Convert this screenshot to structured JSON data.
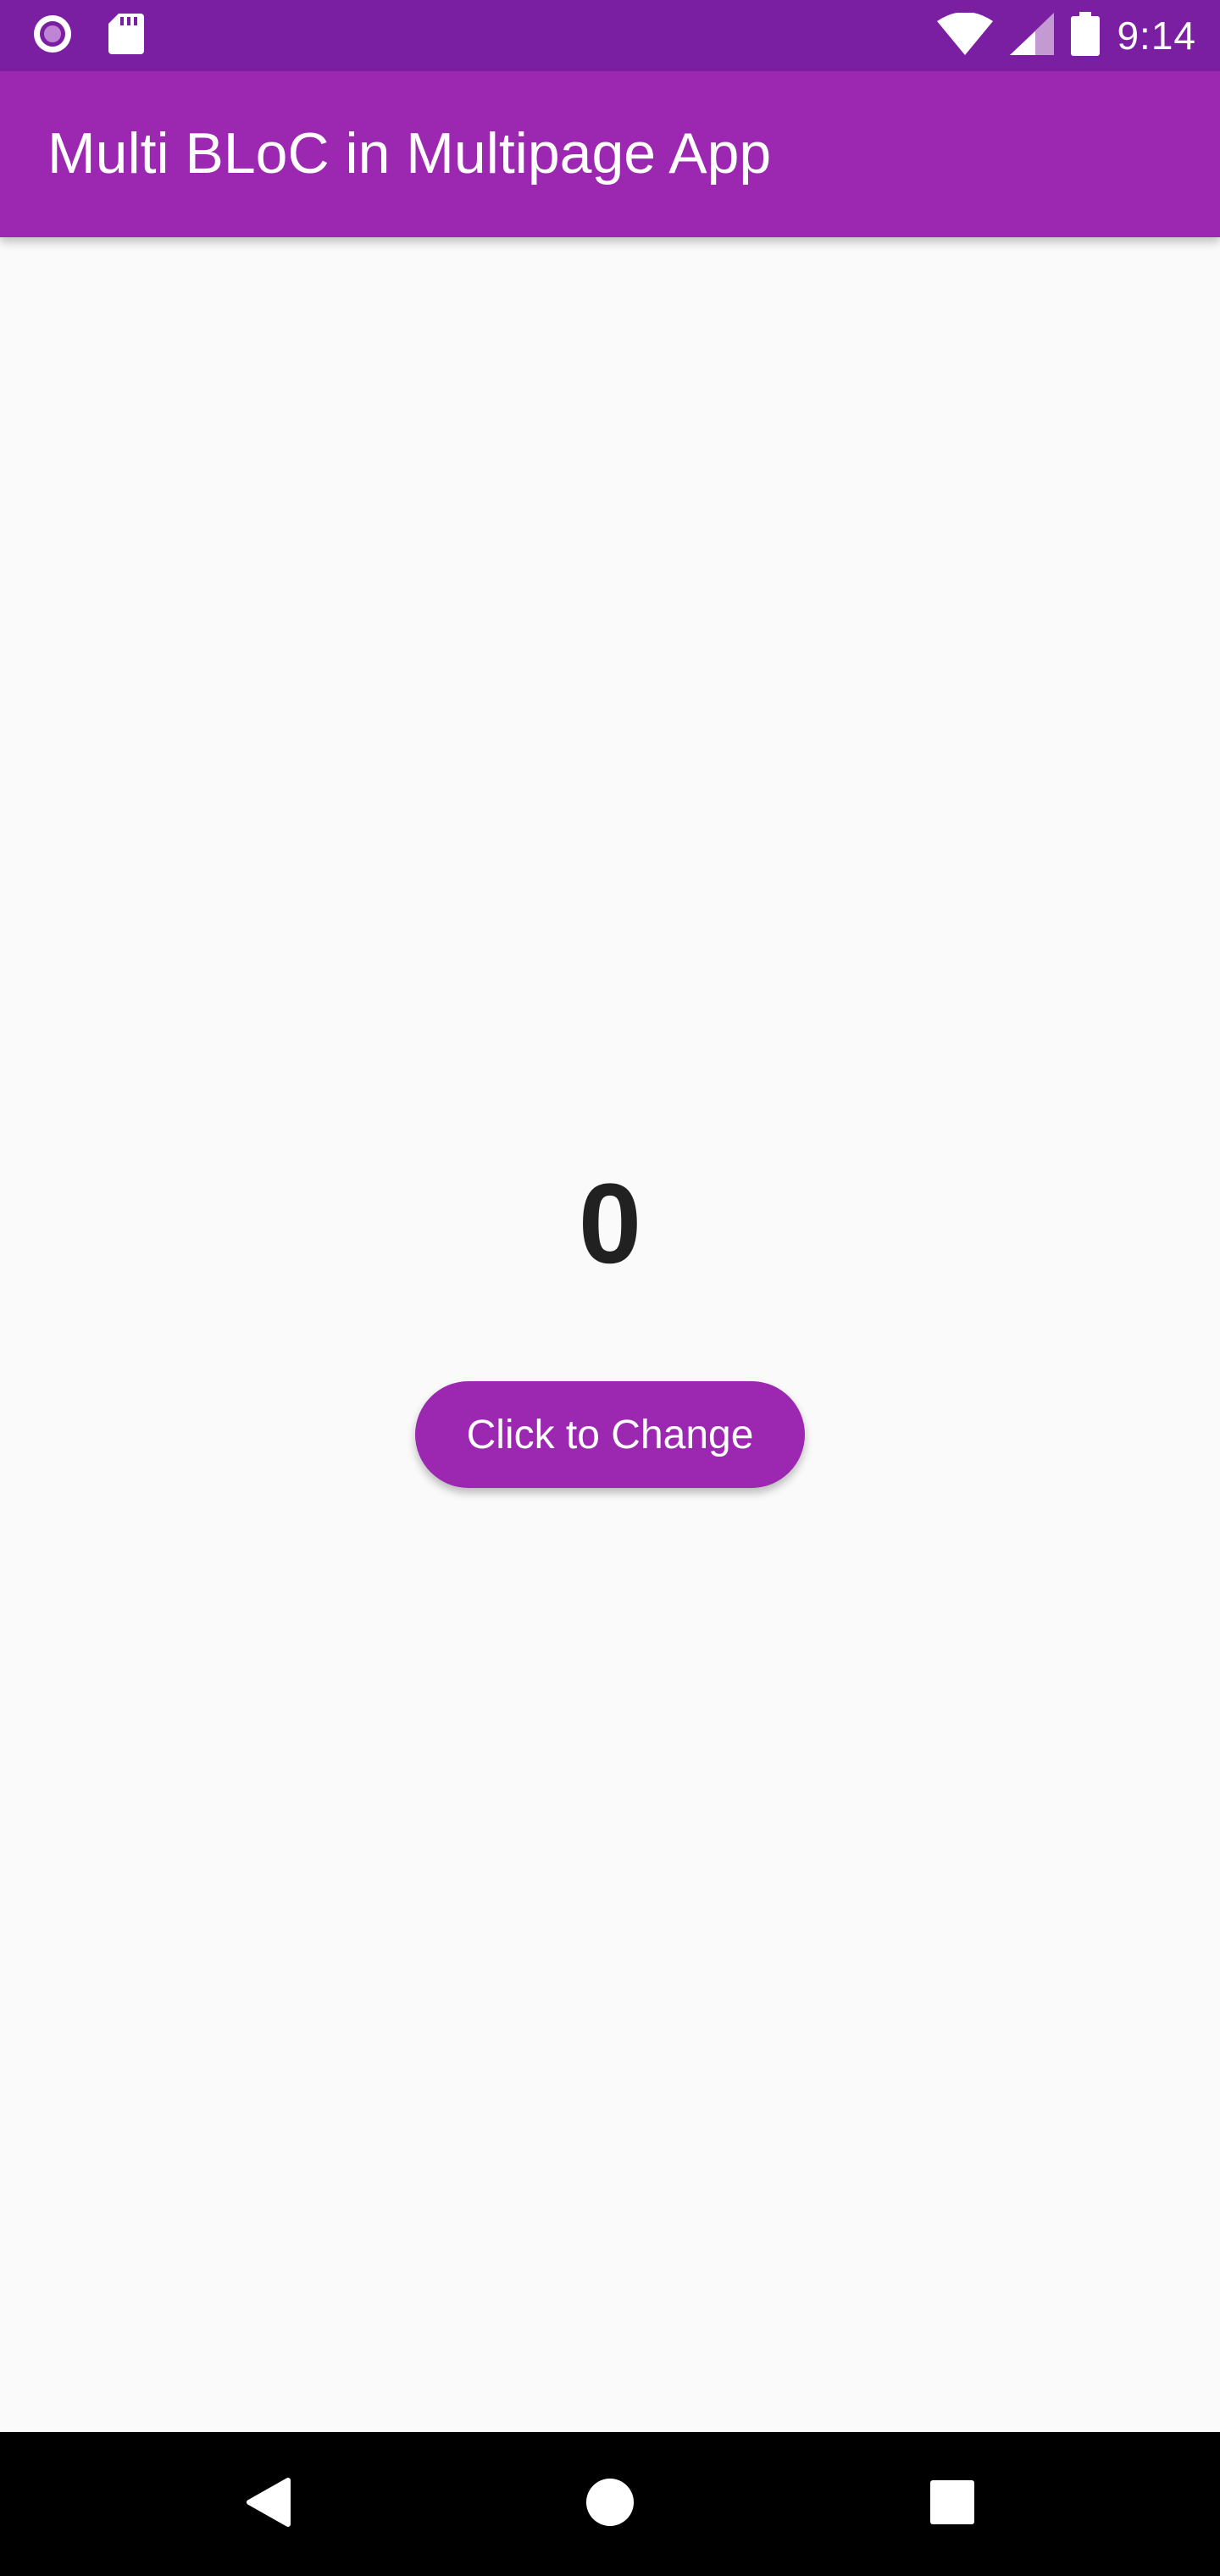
{
  "status_bar": {
    "time": "9:14",
    "icons": [
      "notification-record-icon",
      "sd-card-icon",
      "wifi-icon",
      "signal-icon",
      "battery-icon"
    ]
  },
  "app_bar": {
    "title": "Multi BLoC in Multipage App"
  },
  "main": {
    "counter": "0",
    "button_label": "Click to Change"
  },
  "nav_bar": {
    "buttons": [
      "back-icon",
      "home-icon",
      "recents-icon"
    ]
  },
  "colors": {
    "status_bar": "#7b1fa2",
    "primary": "#9c27b0",
    "background": "#fafafa",
    "counter_text": "#212121",
    "nav_bar": "#000000"
  }
}
